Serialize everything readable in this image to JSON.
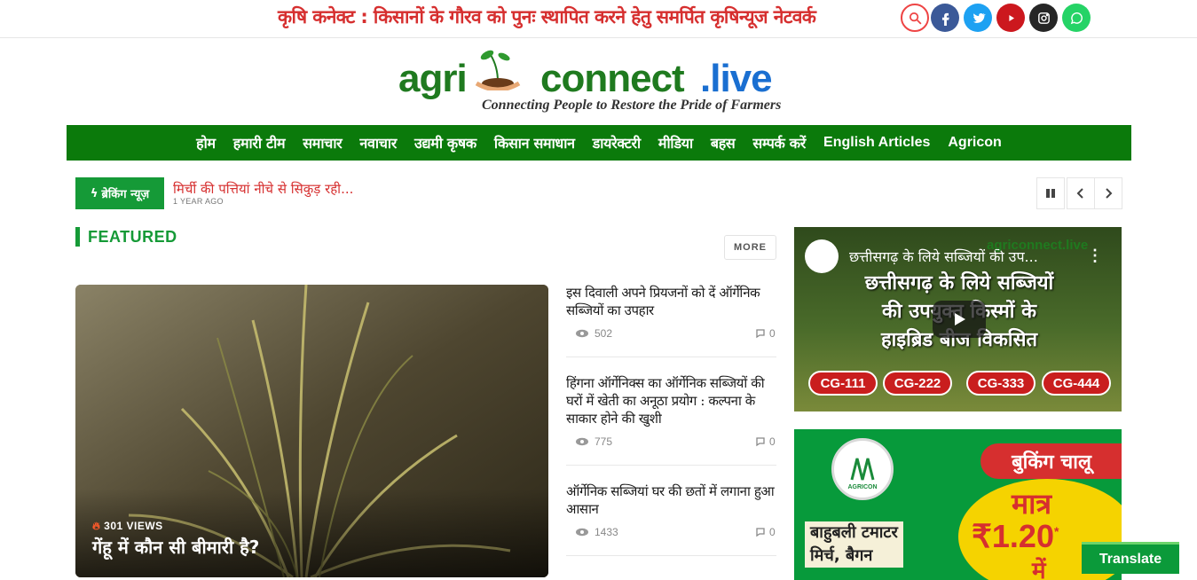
{
  "topbar": {
    "tagline": "कृषि कनेक्ट : किसानों के गौरव को पुनः स्थापित करने हेतु समर्पित कृषिन्यूज नेटवर्क",
    "social": [
      {
        "name": "search",
        "color": "#ffffff"
      },
      {
        "name": "facebook",
        "color": "#3b5998"
      },
      {
        "name": "twitter",
        "color": "#1da1f2"
      },
      {
        "name": "youtube",
        "color": "#cc181e"
      },
      {
        "name": "instagram",
        "color": "#262626"
      },
      {
        "name": "whatsapp",
        "color": "#25d366"
      }
    ]
  },
  "logo": {
    "agri": "agri",
    "connect": "connect",
    "live": ".live",
    "tagline": "Connecting People to Restore the Pride of Farmers"
  },
  "nav": {
    "items": [
      "होम",
      "हमारी टीम",
      "समाचार",
      "नवाचार",
      "उद्यमी कृषक",
      "किसान समाधान",
      "डायरेक्टरी",
      "मीडिया",
      "बहस",
      "सम्पर्क करें",
      "English Articles",
      "Agricon"
    ]
  },
  "breaking": {
    "label": "ब्रेकिंग न्यूज़",
    "title": "मिर्ची की पत्तियां नीचे से सिकुड़ रही...",
    "time": "1 YEAR AGO"
  },
  "featured": {
    "heading": "FEATURED",
    "more": "MORE",
    "main": {
      "views": "301 VIEWS",
      "title": "गेंहू में कौन सी बीमारी है?"
    },
    "items": [
      {
        "title": "इस दिवाली अपने प्रियजनों को दें ऑर्गेनिक सब्जियों का उपहार",
        "views": "502",
        "comments": "0"
      },
      {
        "title": "हिंगना ऑर्गेनिक्स का ऑर्गेनिक सब्जियों की घरों में खेती का अनूठा प्रयोग : कल्पना के साकार होने की खुशी",
        "views": "775",
        "comments": "0"
      },
      {
        "title": "ऑर्गेनिक सब्जियां घर की छतों में लगाना हुआ आसान",
        "views": "1433",
        "comments": "0"
      }
    ]
  },
  "video": {
    "title": "छत्तीसगढ़ के लिये सब्जियों की उप...",
    "banner_line1": "छत्तीसगढ़ के लिये सब्जियों",
    "banner_line2": "की उपयुक्त किस्मों के",
    "banner_line3": "हाइब्रिड बीज विकसित",
    "channel_logo": "agriconnect.live",
    "codes": [
      "CG-111",
      "CG-222",
      "CG-333",
      "CG-444"
    ]
  },
  "ad": {
    "booking": "बुकिंग चालू",
    "matra": "मात्र",
    "price": "₹1.20",
    "price_star": "*",
    "price_suffix": "में",
    "brand": "AGRICON",
    "line1": "बाहुबली टमाटर",
    "line2": "मिर्च, बैगन"
  },
  "translate": "Translate"
}
